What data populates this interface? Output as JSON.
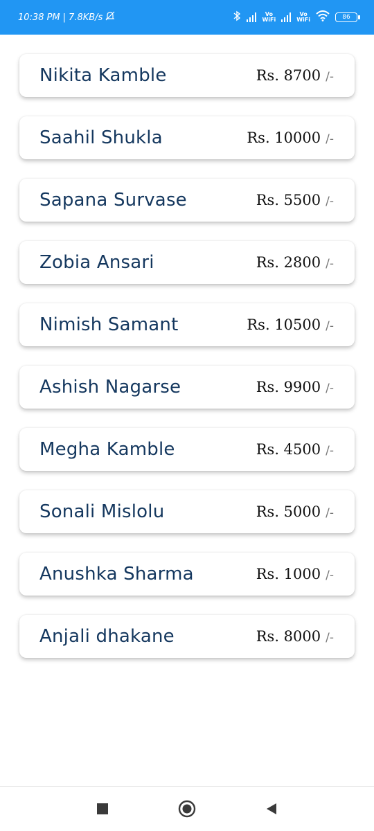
{
  "status_bar": {
    "time": "10:38 PM",
    "speed": "7.8KB/s",
    "vo_label_1": "Vo",
    "wifi_label_1": "WiFi",
    "vo_label_2": "Vo",
    "wifi_label_2": "WiFi",
    "battery": "86"
  },
  "entries": [
    {
      "name": "Nikita Kamble",
      "amount": "Rs. 8700",
      "suffix": "/-"
    },
    {
      "name": "Saahil Shukla",
      "amount": "Rs. 10000",
      "suffix": "/-"
    },
    {
      "name": "Sapana Survase",
      "amount": "Rs. 5500",
      "suffix": "/-"
    },
    {
      "name": "Zobia Ansari",
      "amount": "Rs. 2800",
      "suffix": "/-"
    },
    {
      "name": "Nimish Samant",
      "amount": "Rs. 10500",
      "suffix": "/-"
    },
    {
      "name": "Ashish Nagarse",
      "amount": "Rs. 9900",
      "suffix": "/-"
    },
    {
      "name": "Megha Kamble",
      "amount": "Rs. 4500",
      "suffix": "/-"
    },
    {
      "name": "Sonali Mislolu",
      "amount": "Rs. 5000",
      "suffix": "/-"
    },
    {
      "name": "Anushka Sharma",
      "amount": "Rs. 1000",
      "suffix": "/-"
    },
    {
      "name": "Anjali dhakane",
      "amount": "Rs. 8000",
      "suffix": "/-"
    }
  ],
  "nav": {
    "icons": [
      "recents-square-icon",
      "home-circle-icon",
      "back-triangle-icon"
    ]
  },
  "colors": {
    "status_bar": "#2196f3",
    "name_text": "#14375e",
    "card_bg": "#ffffff"
  }
}
